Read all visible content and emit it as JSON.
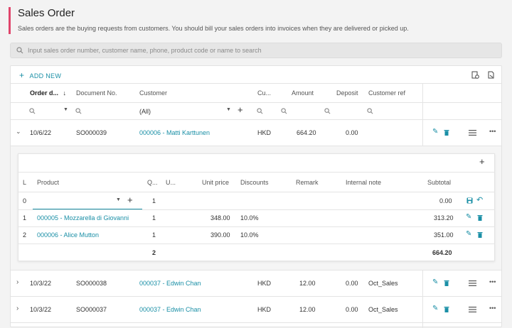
{
  "page": {
    "title": "Sales Order",
    "subtitle": "Sales orders are the buying requests from customers. You should bill your sales orders into invoices when they are delivered or picked up."
  },
  "search": {
    "placeholder": "Input sales order number, customer name, phone, product code or name to search"
  },
  "toolbar": {
    "add_new": "ADD NEW"
  },
  "columns": {
    "order_date": "Order d...",
    "document_no": "Document No.",
    "customer": "Customer",
    "currency": "Cu...",
    "amount": "Amount",
    "deposit": "Deposit",
    "customer_ref": "Customer ref"
  },
  "filters": {
    "customer_select": "(All)"
  },
  "orders": [
    {
      "date": "10/6/22",
      "doc": "SO000039",
      "customer": "000006 - Matti Karttunen",
      "currency": "HKD",
      "amount": "664.20",
      "deposit": "0.00",
      "ref": ""
    },
    {
      "date": "10/3/22",
      "doc": "SO000038",
      "customer": "000037 - Edwin Chan",
      "currency": "HKD",
      "amount": "12.00",
      "deposit": "0.00",
      "ref": "Oct_Sales"
    },
    {
      "date": "10/3/22",
      "doc": "SO000037",
      "customer": "000037 - Edwin Chan",
      "currency": "HKD",
      "amount": "12.00",
      "deposit": "0.00",
      "ref": "Oct_Sales"
    }
  ],
  "lines": {
    "columns": {
      "line": "L",
      "product": "Product",
      "qty": "Q...",
      "unit": "U...",
      "unit_price": "Unit price",
      "discounts": "Discounts",
      "remark": "Remark",
      "internal_note": "Internal note",
      "subtotal": "Subtotal"
    },
    "new_row": {
      "line": "0",
      "qty": "1",
      "subtotal": "0.00"
    },
    "rows": [
      {
        "line": "1",
        "product": "000005 - Mozzarella di Giovanni",
        "qty": "1",
        "unit_price": "348.00",
        "discount": "10.0%",
        "subtotal": "313.20"
      },
      {
        "line": "2",
        "product": "000006 - Alice Mutton",
        "qty": "1",
        "unit_price": "390.00",
        "discount": "10.0%",
        "subtotal": "351.00"
      }
    ],
    "totals": {
      "qty": "2",
      "subtotal": "664.20"
    }
  },
  "colors": {
    "accent": "#1a8fa6",
    "title_bar": "#e0456b"
  },
  "icons": [
    "search-icon",
    "plus-icon",
    "sort-down-icon",
    "export-icon",
    "print-icon",
    "chevron-down-icon",
    "chevron-right-icon",
    "edit-icon",
    "delete-icon",
    "menu-icon",
    "more-icon",
    "save-icon",
    "undo-icon",
    "dropdown-caret-icon"
  ]
}
